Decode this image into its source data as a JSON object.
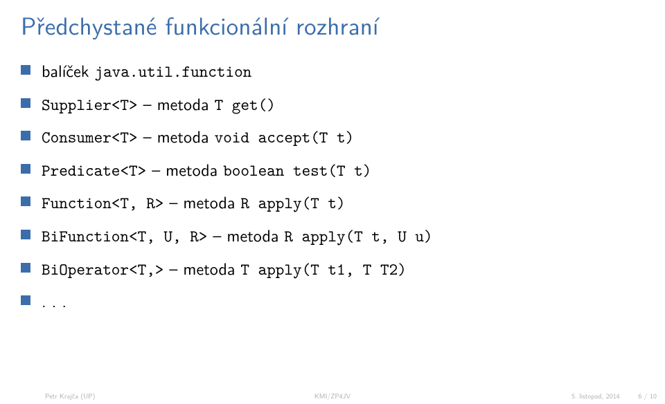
{
  "title": "Předchystané funkcionální rozhraní",
  "items": [
    {
      "text": "balíček ",
      "code": "java.util.function"
    },
    {
      "code": "Supplier<T>",
      "text2": " – metoda ",
      "code2": "T get()"
    },
    {
      "code": "Consumer<T>",
      "text2": " – metoda ",
      "code2": "void accept(T t)"
    },
    {
      "code": "Predicate<T>",
      "text2": " – metoda ",
      "code2": "boolean test(T t)"
    },
    {
      "code": "Function<T, R>",
      "text2": " – metoda ",
      "code2": "R apply(T t)"
    },
    {
      "code": "BiFunction<T, U, R>",
      "text2": " – metoda ",
      "code2": "R apply(T t, U u)"
    },
    {
      "code": "BiOperator<T,>",
      "text2": " – metoda ",
      "code2": "T apply(T t1, T T2)"
    },
    {
      "text": ". . ."
    }
  ],
  "footer": {
    "author": "Petr Krajča (UP)",
    "course": "KMI/ZP4JV",
    "date": "5. listopad, 2014",
    "page": "6 / 10"
  }
}
